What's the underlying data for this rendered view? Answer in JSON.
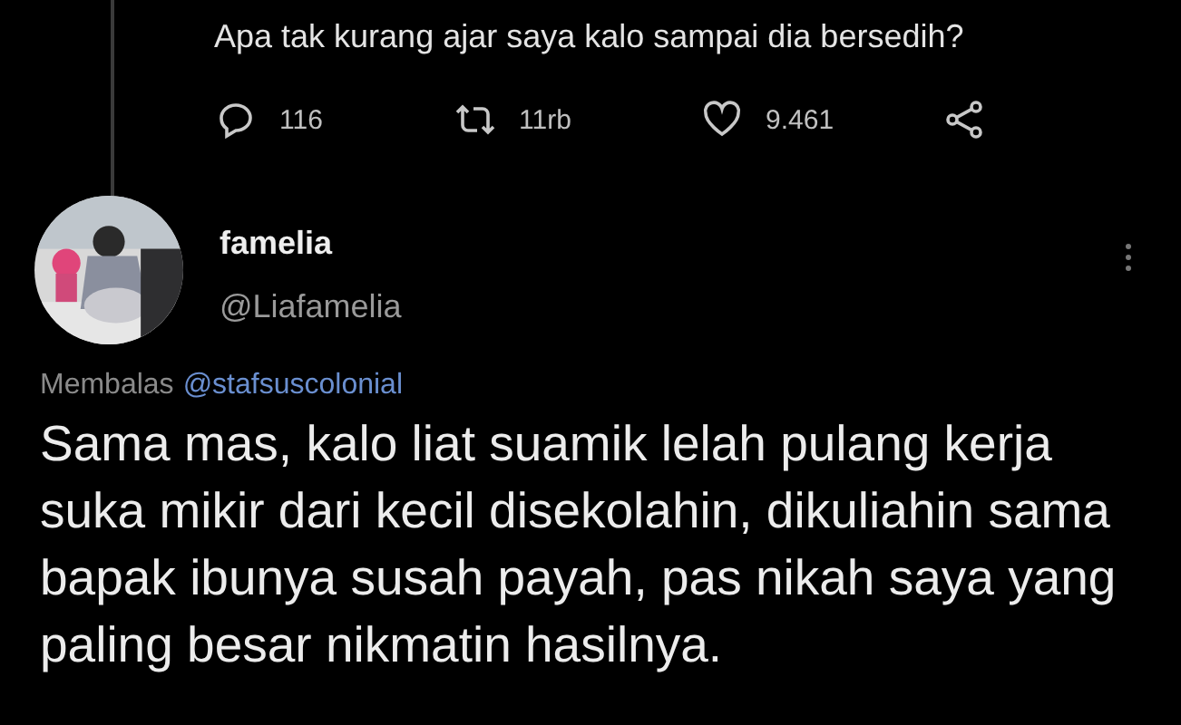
{
  "parent_tweet": {
    "text": "Apa tak kurang ajar saya kalo sampai dia bersedih?",
    "actions": [
      {
        "kind": "reply",
        "count": "116"
      },
      {
        "kind": "retweet",
        "count": "11rb"
      },
      {
        "kind": "like",
        "count": "9.461"
      },
      {
        "kind": "share"
      }
    ]
  },
  "reply_tweet": {
    "name": "famelia",
    "handle": "@Liafamelia",
    "replying_label": "Membalas",
    "replying_to": "@stafsuscolonial",
    "text": "Sama mas, kalo liat suamik lelah pulang kerja suka mikir dari kecil disekolahin, dikuliahin sama bapak ibunya susah payah, pas nikah saya yang paling besar nikmatin hasilnya."
  }
}
